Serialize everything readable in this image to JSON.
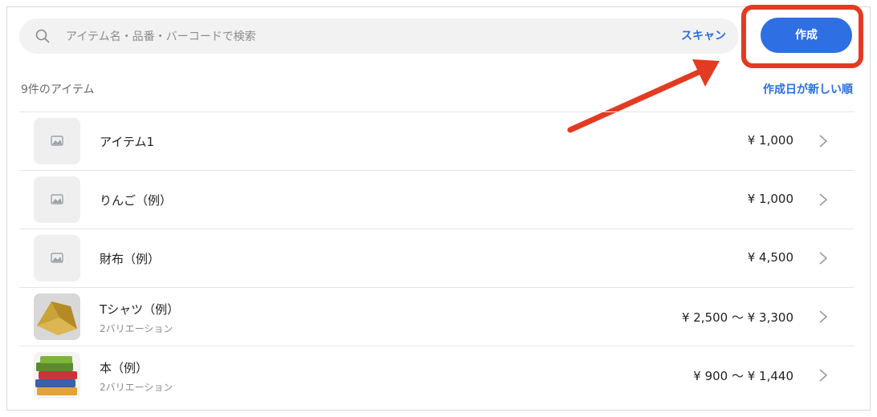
{
  "search": {
    "placeholder": "アイテム名・品番・バーコードで検索",
    "scan_label": "スキャン"
  },
  "toolbar": {
    "create_label": "作成"
  },
  "list_header": {
    "count_label": "9件のアイテム",
    "sort_label": "作成日が新しい順"
  },
  "items": [
    {
      "name": "アイテム1",
      "price": "¥ 1,000",
      "variations": "",
      "image": "placeholder-image-icon"
    },
    {
      "name": "りんご（例）",
      "price": "¥ 1,000",
      "variations": "",
      "image": "placeholder-image-icon"
    },
    {
      "name": "財布（例）",
      "price": "¥ 4,500",
      "variations": "",
      "image": "placeholder-image-icon"
    },
    {
      "name": "Tシャツ（例）",
      "price": "¥ 2,500 〜 ¥ 3,300",
      "variations": "2バリエーション",
      "image": "tshirt-sample-thumbnail"
    },
    {
      "name": "本（例）",
      "price": "¥ 900 〜 ¥ 1,440",
      "variations": "2バリエーション",
      "image": "books-thumbnail"
    }
  ],
  "colors": {
    "accent": "#2f6fe4",
    "highlight": "#e23b22"
  }
}
